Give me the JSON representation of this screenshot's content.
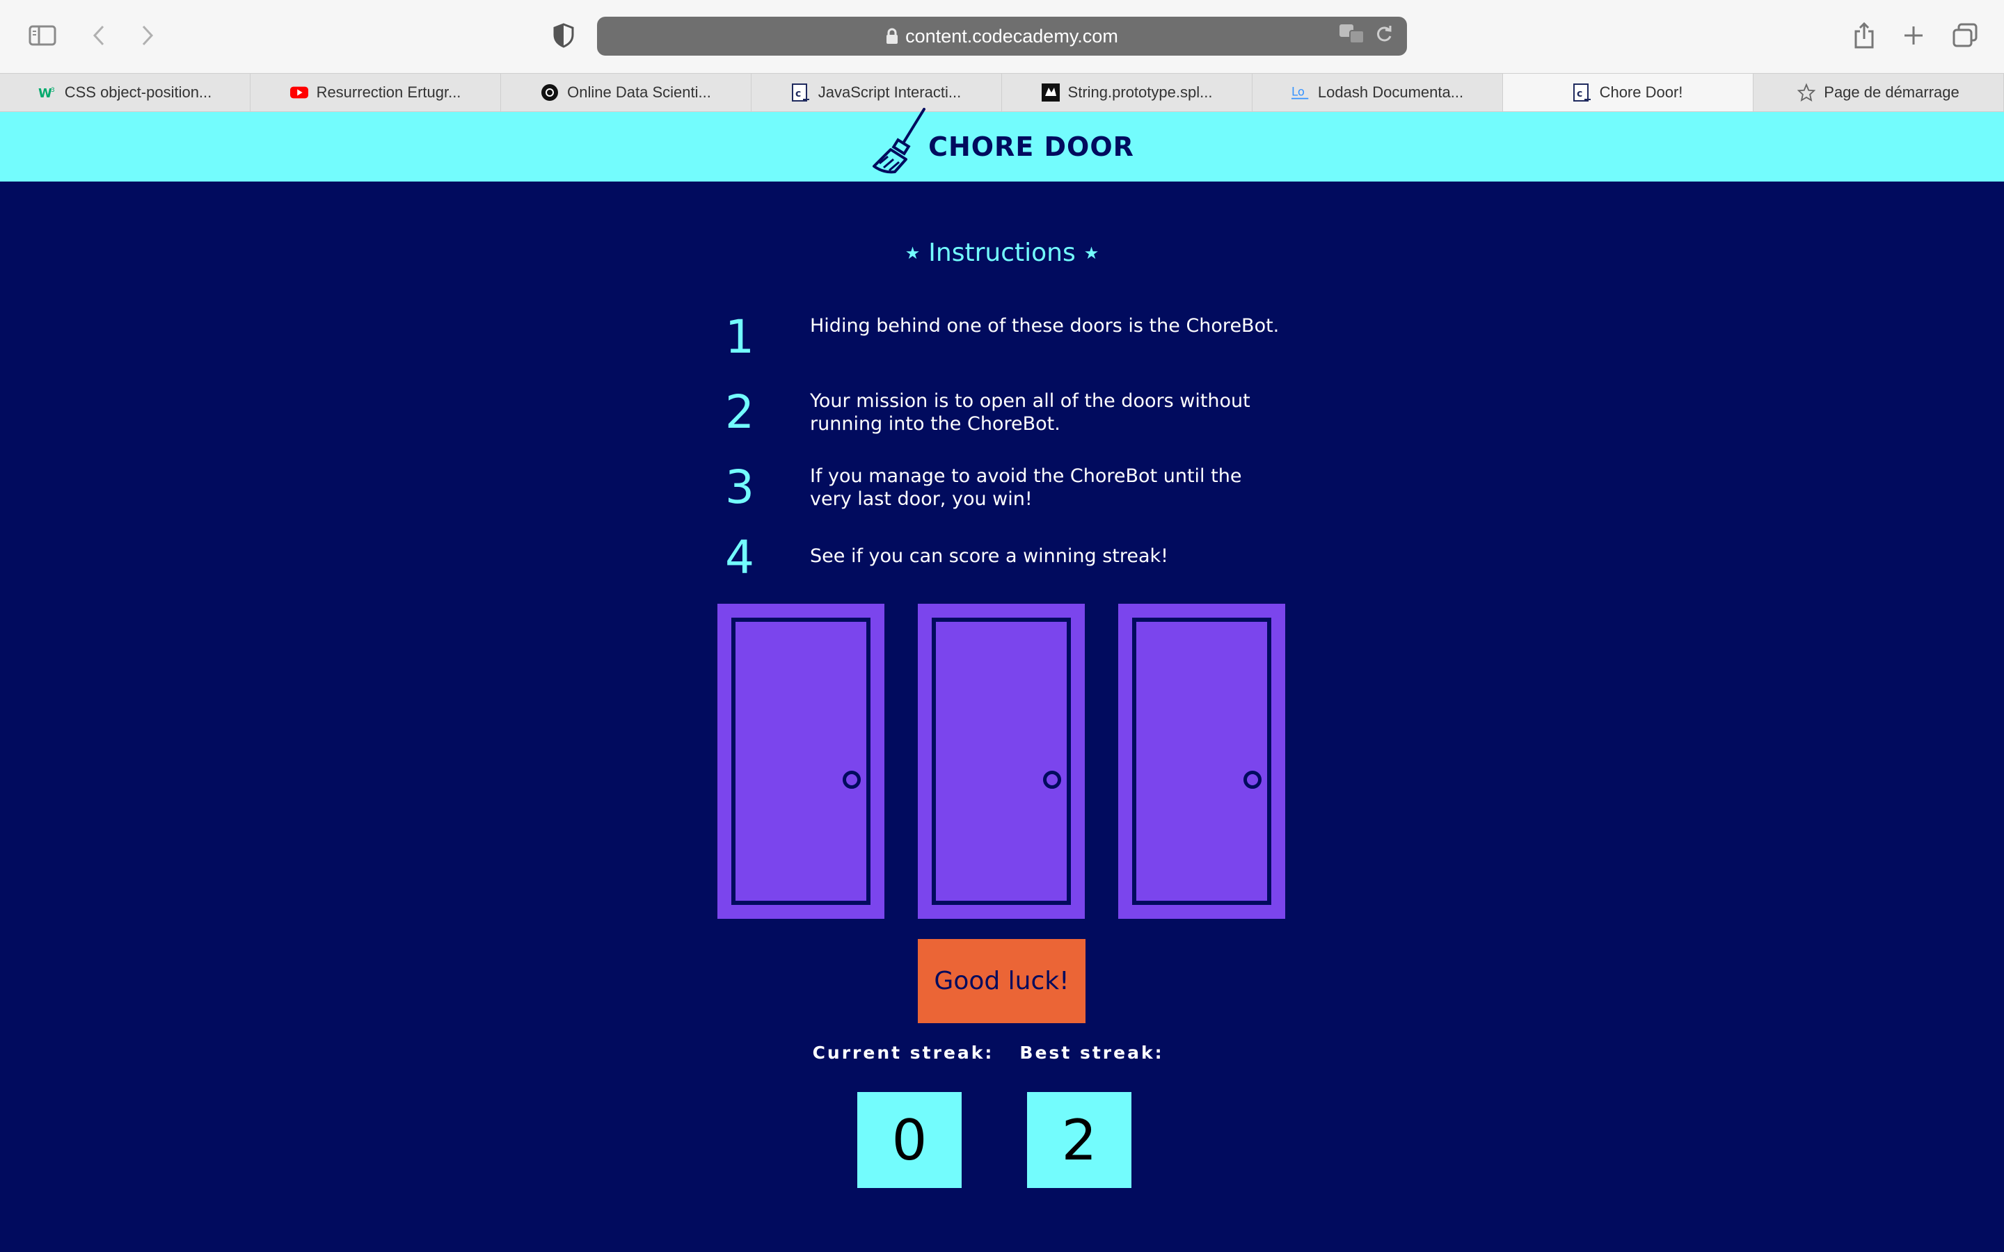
{
  "browser": {
    "url": "content.codecademy.com",
    "tabs": [
      {
        "title": "CSS object-position...",
        "favicon": "w3schools-icon",
        "active": false
      },
      {
        "title": "Resurrection Ertugr...",
        "favicon": "youtube-icon",
        "active": false
      },
      {
        "title": "Online Data Scienti...",
        "favicon": "datascience-icon",
        "active": false
      },
      {
        "title": "JavaScript Interacti...",
        "favicon": "codecademy-icon",
        "active": false
      },
      {
        "title": "String.prototype.spl...",
        "favicon": "mdn-icon",
        "active": false
      },
      {
        "title": "Lodash Documenta...",
        "favicon": "lodash-icon",
        "active": false
      },
      {
        "title": "Chore Door!",
        "favicon": "codecademy-icon",
        "active": true
      },
      {
        "title": "Page de démarrage",
        "favicon": "star-icon",
        "active": false
      }
    ]
  },
  "header": {
    "title": "CHORE DOOR",
    "logo_icon": "broom-icon"
  },
  "instructions": {
    "title": "Instructions",
    "items": [
      {
        "number": "1",
        "text": "Hiding behind one of these doors is the ChoreBot."
      },
      {
        "number": "2",
        "text": "Your mission is to open all of the doors without running into the ChoreBot."
      },
      {
        "number": "3",
        "text": "If you manage to avoid the ChoreBot until the very last door, you win!"
      },
      {
        "number": "4",
        "text": "See if you can score a winning streak!"
      }
    ]
  },
  "game": {
    "start_button": "Good luck!",
    "current_streak_label": "Current streak:",
    "current_streak_value": "0",
    "best_streak_label": "Best streak:",
    "best_streak_value": "2"
  },
  "colors": {
    "background": "#010b5e",
    "header": "#73fcfd",
    "door": "#7b45ed",
    "button": "#eb6536",
    "accent": "#73fcfd"
  }
}
